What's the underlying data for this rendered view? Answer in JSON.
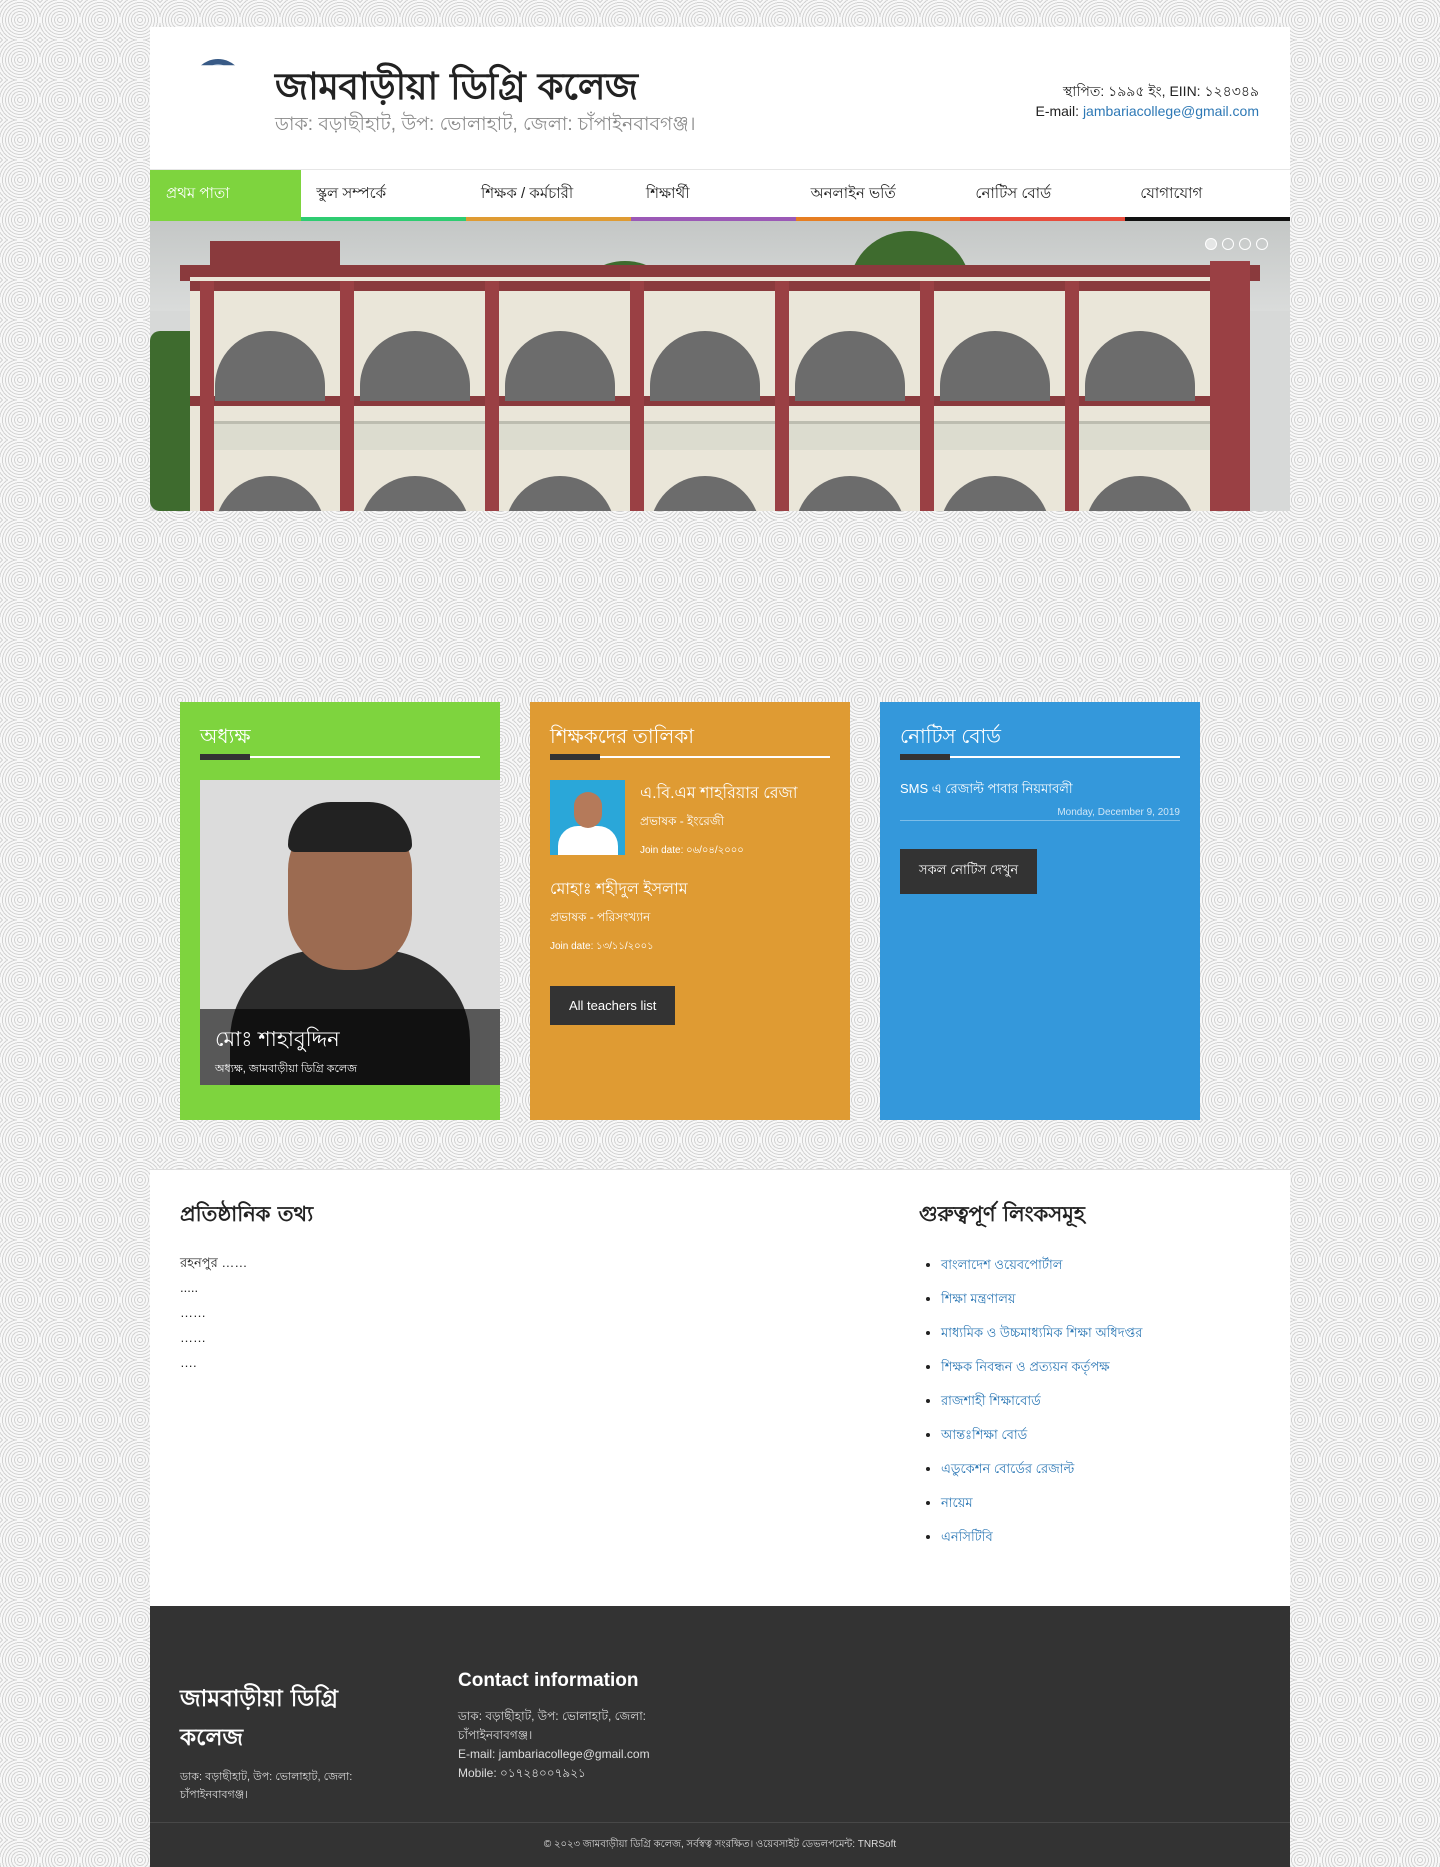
{
  "header": {
    "title": "জামবাড়ীয়া ডিগ্রি কলেজ",
    "subtitle": "ডাক: বড়াছীহাট, উপ: ভোলাহাট, জেলা: চাঁপাইনবাবগঞ্জ।",
    "established": "স্থাপিত: ১৯৯৫ ইং, EIIN: ১২৪৩৪৯",
    "email_label": "E-mail:",
    "email": "jambariacollege@gmail.com"
  },
  "nav": {
    "items": [
      {
        "label": "প্রথম পাতা",
        "color": "#7ed43e"
      },
      {
        "label": "স্কুল সম্পর্কে",
        "color": "#2ecc71"
      },
      {
        "label": "শিক্ষক / কর্মচারী",
        "color": "#df9b33"
      },
      {
        "label": "শিক্ষার্থী",
        "color": "#9b59b6"
      },
      {
        "label": "অনলাইন ভর্তি",
        "color": "#e67e22"
      },
      {
        "label": "নোটিস বোর্ড",
        "color": "#e74c3c"
      },
      {
        "label": "যোগাযোগ",
        "color": "#111111"
      }
    ]
  },
  "principal_box": {
    "title": "অধ্যক্ষ",
    "name": "মোঃ শাহাবুদ্দিন",
    "designation": "অধ্যক্ষ, জামবাড়ীয়া ডিগ্রি কলেজ"
  },
  "teachers_box": {
    "title": "শিক্ষকদের তালিকা",
    "teachers": [
      {
        "name": "এ.বি.এম শাহরিয়ার রেজা",
        "designation": "প্রভাষক - ইংরেজী",
        "join": "Join date: ০৬/০৪/২০০০"
      },
      {
        "name": "মোহাঃ শহীদুল ইসলাম",
        "designation": "প্রভাষক - পরিসংখ্যান",
        "join": "Join date: ১৩/১১/২০০১"
      }
    ],
    "button": "All teachers list"
  },
  "notice_box": {
    "title": "নোটিস বোর্ড",
    "notice": "SMS এ রেজাল্ট পাবার নিয়মাবলী",
    "date": "Monday, December 9, 2019",
    "button": "সকল নোটিস দেখুন"
  },
  "info": {
    "title": "প্রতিষ্ঠানিক তথ্য",
    "lines": [
      "রহনপুর ……",
      ".....",
      "……",
      "……",
      "…."
    ]
  },
  "links": {
    "title": "গুরুত্বপূর্ণ লিংকসমূহ",
    "items": [
      "বাংলাদেশ ওয়েবপোর্টাল",
      "শিক্ষা মন্ত্রণালয়",
      "মাধ্যমিক ও উচ্চমাধ্যমিক শিক্ষা অধিদপ্তর",
      "শিক্ষক নিবন্ধন ও প্রত্যয়ন কর্তৃপক্ষ",
      "রাজশাহী শিক্ষাবোর্ড",
      "আন্তঃশিক্ষা বোর্ড",
      "এডুকেশন বোর্ডের রেজাল্ট",
      "নায়েম",
      "এনসিটিবি"
    ]
  },
  "footer": {
    "title": "জামবাড়ীয়া ডিগ্রি কলেজ",
    "address": "ডাক: বড়াছীহাট, উপ: ভোলাহাট, জেলা: চাঁপাইনবাবগঞ্জ।",
    "contact_title": "Contact information",
    "contact_address": "ডাক: বড়াছীহাট, উপ: ভোলাহাট, জেলা: চাঁপাইনবাবগঞ্জ।",
    "contact_email": "E-mail: jambariacollege@gmail.com",
    "contact_mobile": "Mobile: ০১৭২৪০০৭৯২১",
    "copyright": "© ২০২৩ জামবাড়ীয়া ডিগ্রি কলেজ, সর্বস্বত্ব সংরক্ষিত। ওয়েবসাইট ডেভলপমেন্ট: TNRSoft"
  },
  "slider": {
    "dot_count": 4
  }
}
